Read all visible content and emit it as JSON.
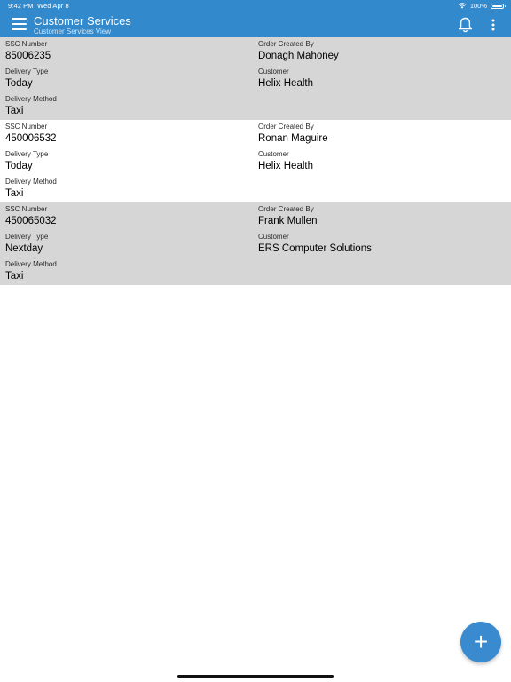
{
  "status_bar": {
    "time": "9:42 PM",
    "date": "Wed Apr 8",
    "battery": "100%"
  },
  "header": {
    "title": "Customer Services",
    "subtitle": "Customer Services View"
  },
  "labels": {
    "ssc_number": "SSC Number",
    "order_created_by": "Order Created By",
    "delivery_type": "Delivery Type",
    "customer": "Customer",
    "delivery_method": "Delivery Method"
  },
  "records": [
    {
      "ssc_number": "85006235",
      "order_created_by": "Donagh Mahoney",
      "delivery_type": "Today",
      "customer": "Helix Health",
      "delivery_method": "Taxi"
    },
    {
      "ssc_number": "450006532",
      "order_created_by": "Ronan Maguire",
      "delivery_type": "Today",
      "customer": "Helix Health",
      "delivery_method": "Taxi"
    },
    {
      "ssc_number": "450065032",
      "order_created_by": "Frank Mullen",
      "delivery_type": "Nextday",
      "customer": "ERS Computer Solutions",
      "delivery_method": "Taxi"
    }
  ],
  "fab": {
    "label": "+"
  },
  "colors": {
    "header_bg": "#3289cc",
    "row_shaded": "#d6d6d6",
    "fab_bg": "#3a8ad0"
  },
  "icons": [
    "menu-icon",
    "bell-icon",
    "more-vertical-icon",
    "wifi-icon",
    "battery-icon",
    "plus-icon"
  ]
}
